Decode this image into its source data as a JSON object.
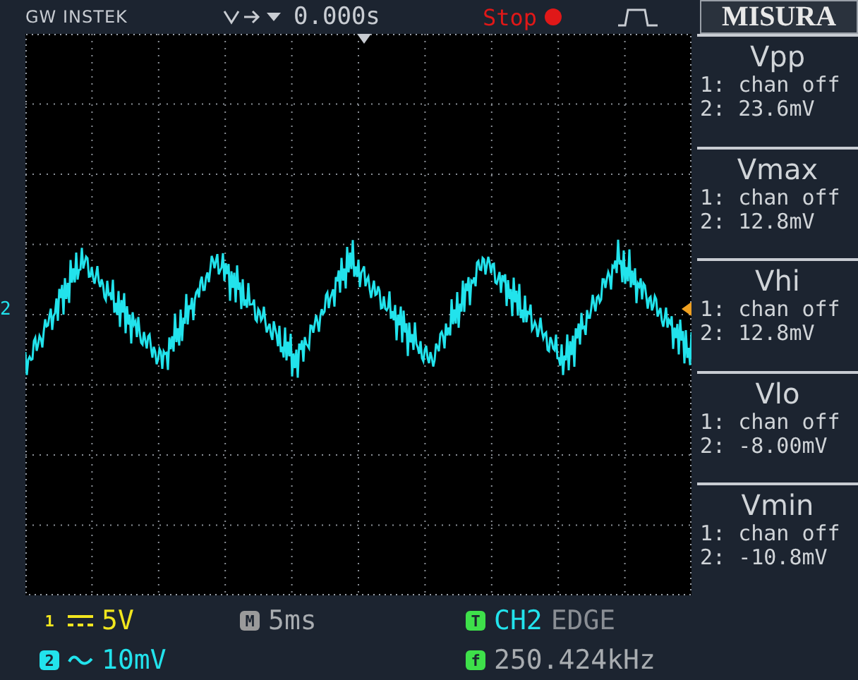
{
  "header": {
    "brand": "GW INSTEK",
    "time_offset": "0.000s",
    "run_state": {
      "label": "Stop",
      "running": false
    },
    "mode_label": "MISURA"
  },
  "screen": {
    "channel_marker": "2"
  },
  "measurements": [
    {
      "name": "Vpp",
      "ch1": "1: chan off",
      "ch2": "2: 23.6mV"
    },
    {
      "name": "Vmax",
      "ch1": "1: chan off",
      "ch2": "2: 12.8mV"
    },
    {
      "name": "Vhi",
      "ch1": "1: chan off",
      "ch2": "2: 12.8mV"
    },
    {
      "name": "Vlo",
      "ch1": "1: chan off",
      "ch2": "2: -8.00mV"
    },
    {
      "name": "Vmin",
      "ch1": "1: chan off",
      "ch2": "2: -10.8mV"
    }
  ],
  "footer": {
    "channels": [
      {
        "badge": "1",
        "kind": "dc",
        "scale": "5V",
        "color": "#f2e61e"
      },
      {
        "badge": "2",
        "kind": "ac",
        "scale": "10mV",
        "color": "#22e3ec"
      }
    ],
    "timebase": {
      "badge": "M",
      "value": "5ms"
    },
    "trigger": {
      "badge": "T",
      "source": "CH2",
      "type": "EDGE"
    },
    "frequency": {
      "badge": "f",
      "value": "250.424kHz"
    }
  }
}
